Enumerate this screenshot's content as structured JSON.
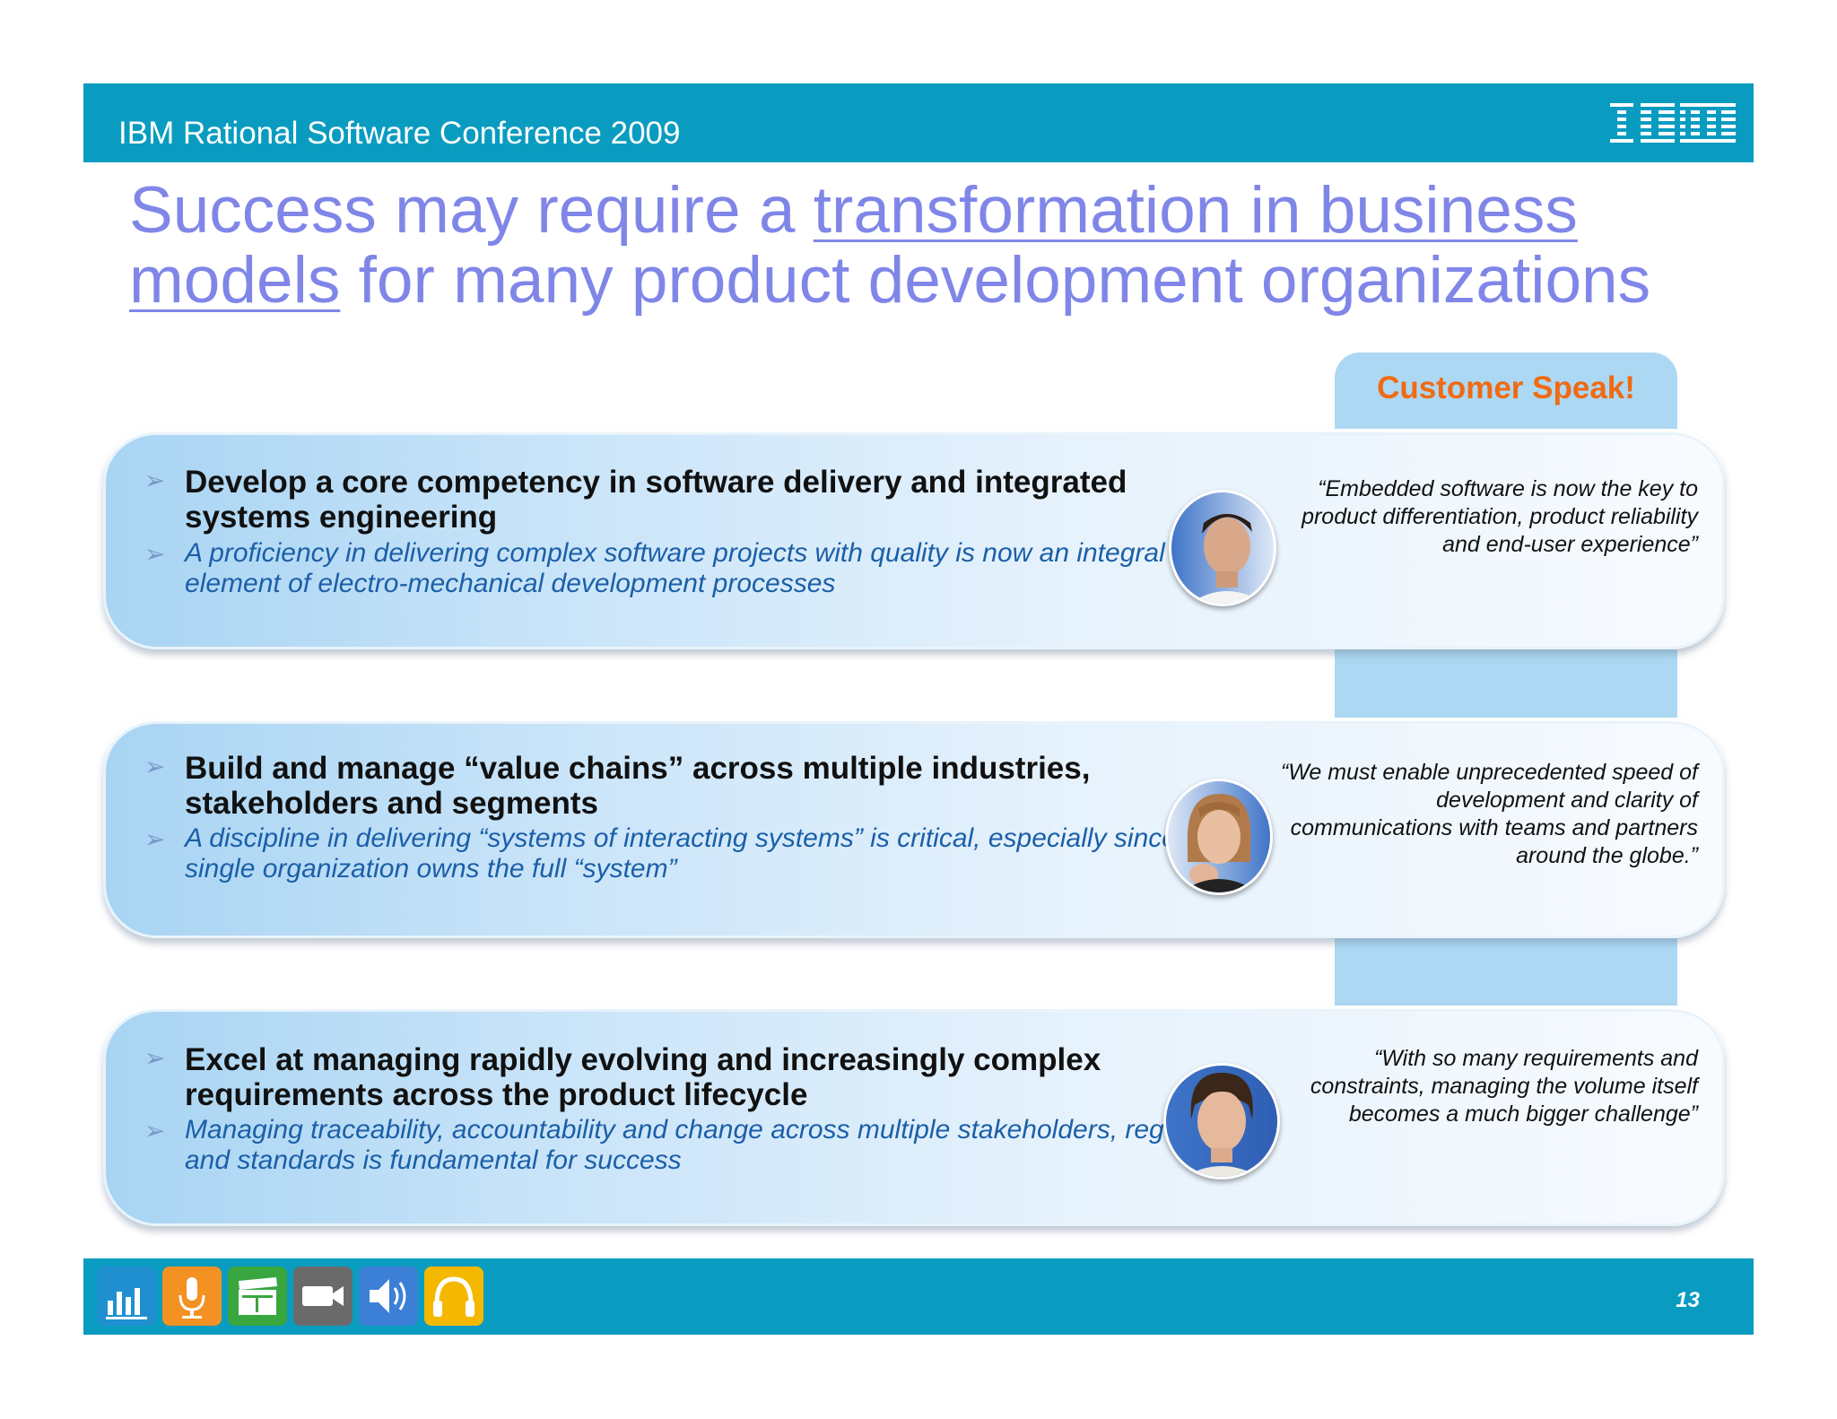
{
  "header": {
    "conference": "IBM Rational Software Conference 2009",
    "logo": "IBM"
  },
  "title": {
    "part1": "Success may require a ",
    "link1": "transformation in business",
    "link2": "models",
    "part2": " for many product development organizations"
  },
  "customer_speak": {
    "label": "Customer Speak!"
  },
  "rows": [
    {
      "main": "Develop a core competency in software delivery and integrated systems engineering",
      "sub": "A proficiency in delivering complex software projects with quality is now an integral element of electro-mechanical development processes",
      "quote": "“Embedded software is now the key to product differentiation, product reliability and end-user experience”",
      "avatar": "man-portrait"
    },
    {
      "main": "Build and manage “value chains” across multiple industries, stakeholders and segments",
      "sub": "A discipline in delivering “systems of interacting systems” is critical, especially since no single organization owns the full “system”",
      "quote": "“We must enable unprecedented speed of development and clarity of communications with teams and partners around the globe.”",
      "avatar": "woman-portrait"
    },
    {
      "main": "Excel at managing rapidly evolving and increasingly complex requirements across the product lifecycle",
      "sub": "Managing traceability, accountability and change across multiple stakeholders, regulations and standards is fundamental for success",
      "quote": "“With so many requirements and constraints, managing the volume itself becomes a much bigger challenge”",
      "avatar": "young-man-portrait"
    }
  ],
  "footer": {
    "page_number": "13",
    "icons": [
      {
        "name": "equalizer-icon",
        "color": "#1f8fd0"
      },
      {
        "name": "microphone-icon",
        "color": "#f39122"
      },
      {
        "name": "clapperboard-icon",
        "color": "#3aa63f"
      },
      {
        "name": "video-camera-icon",
        "color": "#6a6a6a"
      },
      {
        "name": "speaker-icon",
        "color": "#3c7fd6"
      },
      {
        "name": "headphones-icon",
        "color": "#f4b800"
      }
    ]
  }
}
